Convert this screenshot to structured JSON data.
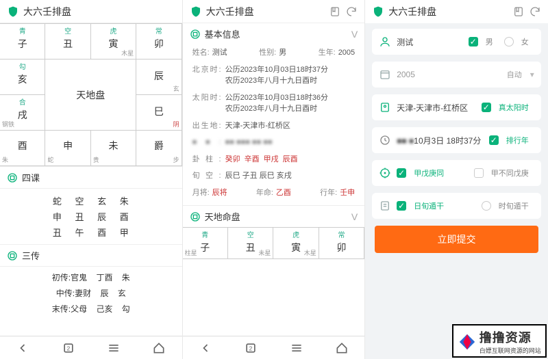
{
  "app": {
    "title": "大六壬排盘"
  },
  "tiandi": {
    "center_label": "天地盘",
    "cells": [
      {
        "top": "青",
        "mid": "子",
        "bl": "",
        "br": ""
      },
      {
        "top": "空",
        "mid": "丑",
        "bl": "",
        "br": ""
      },
      {
        "top": "虎",
        "mid": "寅",
        "bl": "",
        "br": "木星"
      },
      {
        "top": "常",
        "mid": "卯",
        "bl": "",
        "br": ""
      },
      {
        "top": "勾",
        "mid": "亥",
        "bl": "",
        "br": ""
      },
      {
        "top": "",
        "mid": "辰",
        "bl": "",
        "br": "玄"
      },
      {
        "top": "合",
        "mid": "戌",
        "bl": "钢铁",
        "br": ""
      },
      {
        "top": "",
        "mid": "巳",
        "bl": "",
        "br": "阴"
      },
      {
        "top": "",
        "mid": "酉",
        "bl": "朱",
        "br": ""
      },
      {
        "top": "",
        "mid": "申",
        "bl": "蛇",
        "br": ""
      },
      {
        "top": "",
        "mid": "未",
        "bl": "贵",
        "br": ""
      },
      {
        "top": "",
        "mid": "爵",
        "bl": "",
        "br": "步"
      }
    ]
  },
  "sike": {
    "title": "四课",
    "rows": [
      "蛇 空 玄 朱",
      "申 丑 辰 酉",
      "丑 午 酉 甲"
    ]
  },
  "sanchuan": {
    "title": "三传",
    "rows": [
      {
        "lab": "初传:",
        "v": "官鬼 丁酉 朱"
      },
      {
        "lab": "中传:",
        "v": "妻财 辰 玄"
      },
      {
        "lab": "末传:",
        "v": "父母 己亥 勾"
      }
    ]
  },
  "info": {
    "title": "基本信息",
    "name_lbl": "姓名:",
    "name": "测试",
    "sex_lbl": "性别:",
    "sex": "男",
    "year_lbl": "生年:",
    "year": "2005",
    "bj_lbl": "北京时:",
    "bj_v1": "公历2023年10月03日18时37分",
    "bj_v2": "农历2023年八月十九日酉时",
    "sun_lbl": "太阳时:",
    "sun_v1": "公历2023年10月03日18时36分",
    "sun_v2": "农历2023年八月十九日酉时",
    "birth_lbl": "出生地:",
    "birth": "天津-天津市-红桥区",
    "blur_lbl": "",
    "blur": "",
    "gua_lbl": "卦柱:",
    "gua_vals": [
      "癸卯",
      "辛酉",
      "甲戌",
      "辰酉"
    ],
    "xun_lbl": "旬空:",
    "xun": "辰巳 子丑 辰巳 亥戌",
    "yue_lbl": "月将:",
    "yue": "辰将",
    "nian_lbl": "年命:",
    "nian": "乙酉",
    "xing_lbl": "行年:",
    "xing": "壬申"
  },
  "pan2_title": "天地命盘",
  "form": {
    "name": "测试",
    "male": "男",
    "female": "女",
    "year": "2005",
    "auto": "自动",
    "loc": "天津-天津市-红桥区",
    "true_sun": "真太阳时",
    "dt": "10月3日 18时37分",
    "row_year": "排行年",
    "jia": "甲戊庚同",
    "jia2": "甲不同戊庚",
    "ri": "日旬遁干",
    "shi": "时旬遁干",
    "submit": "立即提交"
  },
  "nav": {
    "back": "‹",
    "tabs": "",
    "menu": "",
    "home": ""
  },
  "brand": {
    "name": "撸撸资源",
    "sub": "白嫖互联网资源的网站"
  }
}
